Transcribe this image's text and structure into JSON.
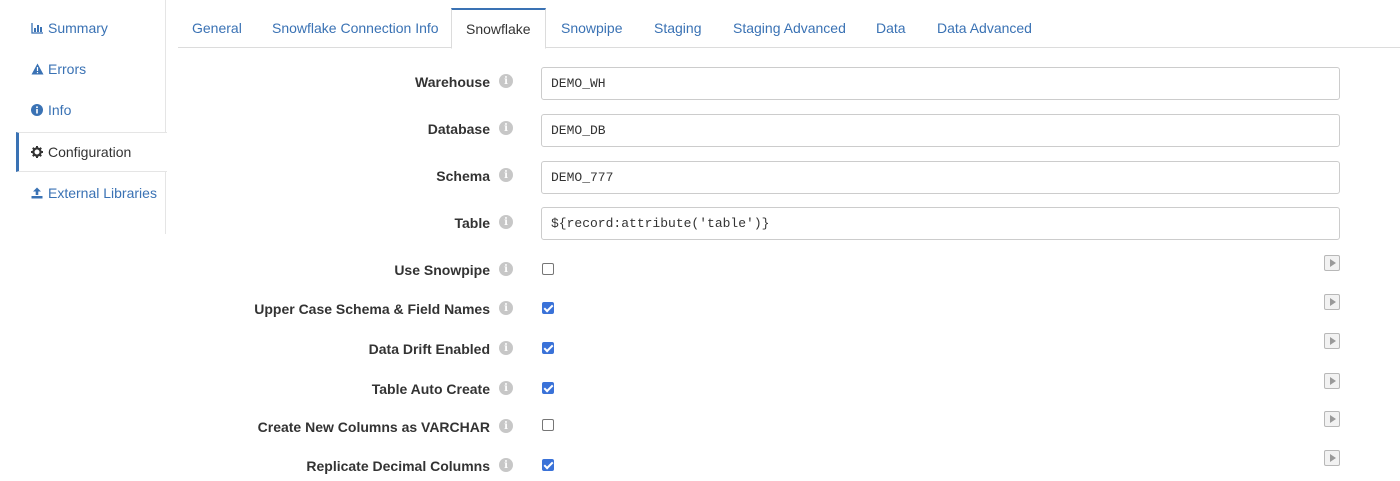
{
  "sidebar": {
    "items": [
      {
        "label": "Summary",
        "icon": "bar-chart-icon"
      },
      {
        "label": "Errors",
        "icon": "warning-icon"
      },
      {
        "label": "Info",
        "icon": "info-icon"
      },
      {
        "label": "Configuration",
        "icon": "gear-icon",
        "active": true
      },
      {
        "label": "External Libraries",
        "icon": "upload-icon"
      }
    ]
  },
  "tabs": [
    {
      "label": "General"
    },
    {
      "label": "Snowflake Connection Info"
    },
    {
      "label": "Snowflake",
      "active": true
    },
    {
      "label": "Snowpipe"
    },
    {
      "label": "Staging"
    },
    {
      "label": "Staging Advanced"
    },
    {
      "label": "Data"
    },
    {
      "label": "Data Advanced"
    }
  ],
  "form": {
    "text_fields": [
      {
        "label": "Warehouse",
        "value": "DEMO_WH"
      },
      {
        "label": "Database",
        "value": "DEMO_DB"
      },
      {
        "label": "Schema",
        "value": "DEMO_777"
      },
      {
        "label": "Table",
        "value": "${record:attribute('table')}"
      }
    ],
    "checkboxes": [
      {
        "label": "Use Snowpipe",
        "checked": false
      },
      {
        "label": "Upper Case Schema & Field Names",
        "checked": true
      },
      {
        "label": "Data Drift Enabled",
        "checked": true
      },
      {
        "label": "Table Auto Create",
        "checked": true
      },
      {
        "label": "Create New Columns as VARCHAR",
        "checked": false
      },
      {
        "label": "Replicate Decimal Columns",
        "checked": true
      }
    ],
    "info_glyph": "i"
  },
  "colors": {
    "link": "#3a72b4",
    "checkbox_checked": "#3a72d8",
    "active_tab_border": "#3a72b4"
  }
}
